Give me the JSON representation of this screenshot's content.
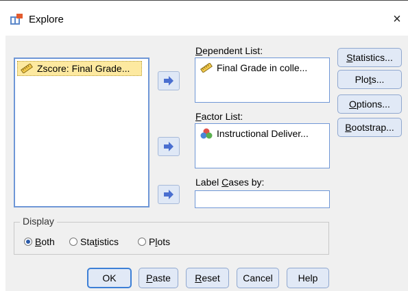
{
  "window": {
    "title": "Explore",
    "close_label": "×",
    "icon": "explore-app-icon"
  },
  "source_list": {
    "items": [
      {
        "label": "Zscore:  Final Grade...",
        "icon": "ruler-icon",
        "selected": true
      }
    ]
  },
  "move_button_icon": "arrow-right-icon",
  "dependent_list": {
    "label_underlined": "D",
    "label_rest": "ependent List:",
    "items": [
      {
        "label": "Final Grade in colle...",
        "icon": "ruler-icon"
      }
    ]
  },
  "factor_list": {
    "label_underlined": "F",
    "label_rest": "actor List:",
    "items": [
      {
        "label": "Instructional Deliver...",
        "icon": "nominal-icon"
      }
    ]
  },
  "label_cases": {
    "label_before": "Label ",
    "label_underlined": "C",
    "label_after": "ases by:",
    "value": ""
  },
  "side_buttons": {
    "statistics": {
      "u": "S",
      "rest": "tatistics..."
    },
    "plots": {
      "before": "Plo",
      "u": "t",
      "after": "s..."
    },
    "options": {
      "u": "O",
      "rest": "ptions..."
    },
    "bootstrap": {
      "u": "B",
      "rest": "ootstrap..."
    }
  },
  "display": {
    "legend": "Display",
    "both": {
      "u": "B",
      "rest": "oth",
      "selected": true
    },
    "statistics": {
      "before": "Sta",
      "u": "t",
      "after": "istics",
      "selected": false
    },
    "plots": {
      "before": "P",
      "u": "l",
      "after": "ots",
      "selected": false
    }
  },
  "bottom_buttons": {
    "ok": "OK",
    "paste": {
      "u": "P",
      "rest": "aste"
    },
    "reset": {
      "u": "R",
      "rest": "eset"
    },
    "cancel": "Cancel",
    "help": "Help"
  },
  "colors": {
    "listbox_border": "#6e96d6",
    "selection": "#fde9a0",
    "button_fill": "#e1e9f6",
    "arrow_fill": "#4a6fd0"
  }
}
